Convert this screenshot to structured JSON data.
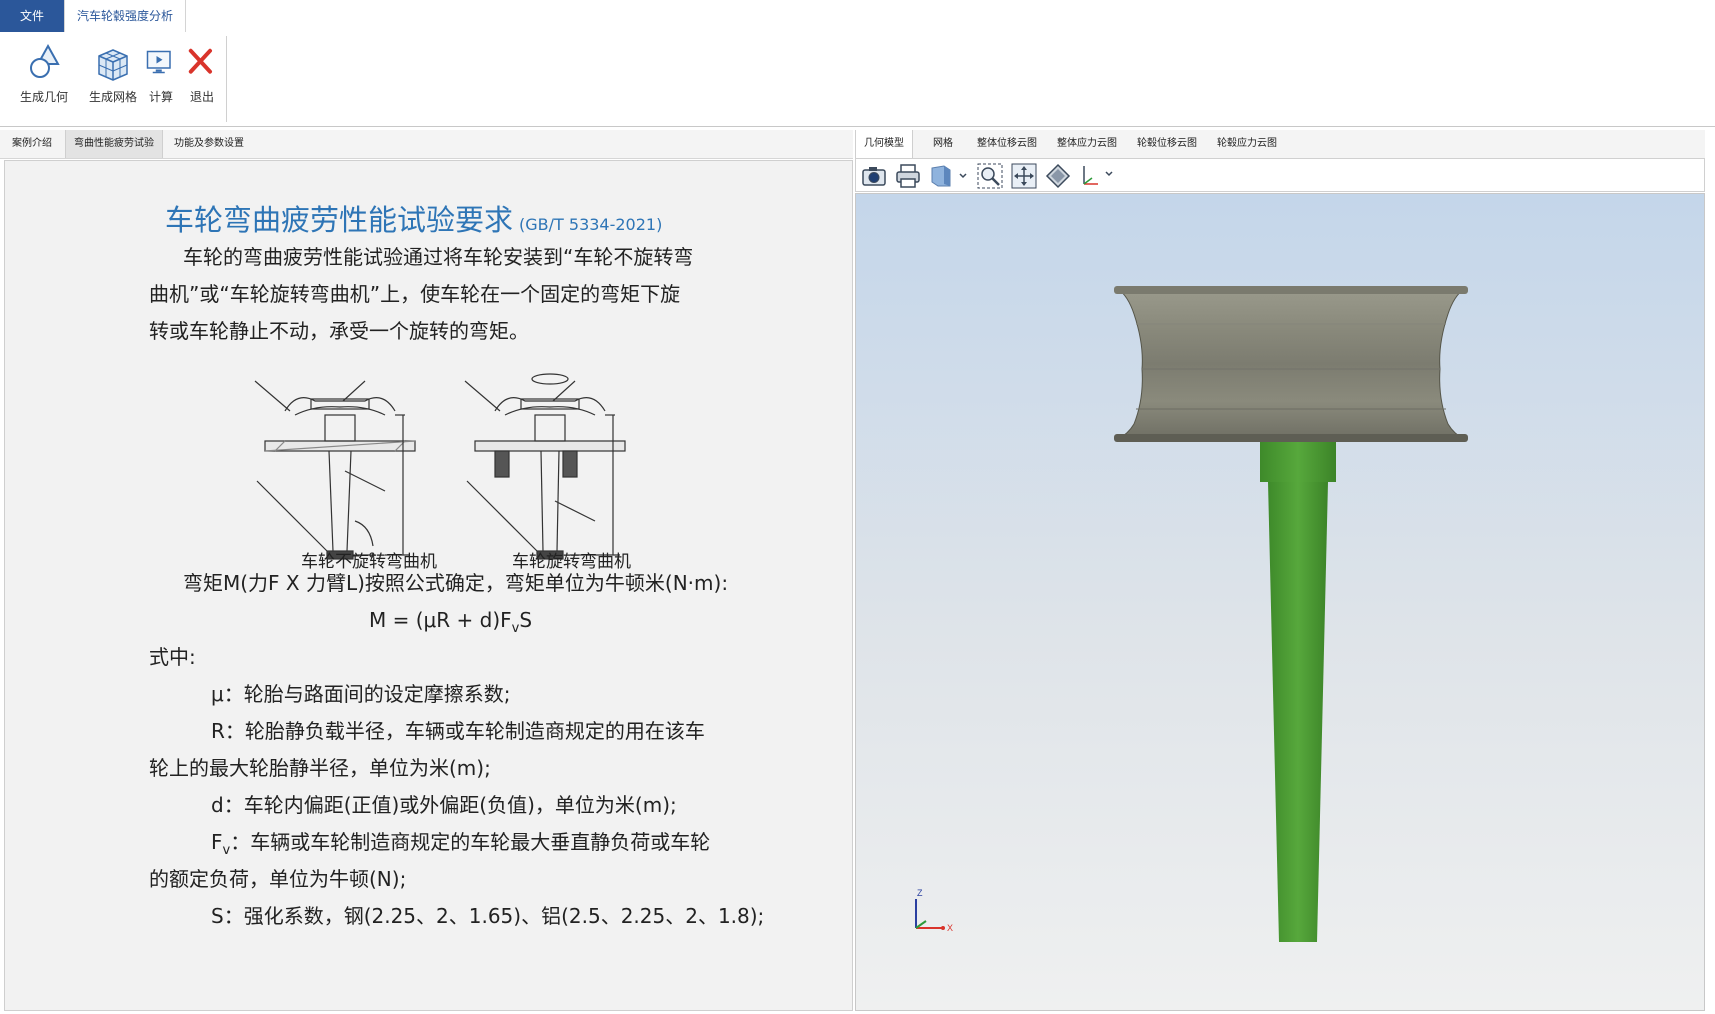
{
  "ribbon_tabs": {
    "file": "文件",
    "analysis": "汽车轮毂强度分析"
  },
  "ribbon": {
    "gen_geometry": "生成几何",
    "gen_mesh": "生成网格",
    "compute": "计算",
    "exit": "退出"
  },
  "left_tabs": [
    "案例介绍",
    "弯曲性能疲劳试验",
    "功能及参数设置"
  ],
  "left_active_tab": "弯曲性能疲劳试验",
  "doc": {
    "title": "车轮弯曲疲劳性能试验要求",
    "title_std": "(GB/T 5334-2021)",
    "intro": [
      "车轮的弯曲疲劳性能试验通过将车轮安装到“车轮不旋转弯",
      "曲机”或“车轮旋转弯曲机”上，使车轮在一个固定的弯矩下旋",
      "转或车轮静止不动，承受一个旋转的弯矩。"
    ],
    "fig_caption_left": "车轮不旋转弯曲机",
    "fig_caption_right": "车轮旋转弯曲机",
    "moment_text": "弯矩M(力F X 力臂L)按照公式确定，弯矩单位为牛顿米(N·m):",
    "formula_prefix": "M = (μR + d)F",
    "formula_sub": "v",
    "formula_suffix": "S",
    "where": "式中:",
    "mu": "μ：轮胎与路面间的设定摩擦系数;",
    "r_line1": "R：轮胎静负载半径，车辆或车轮制造商规定的用在该车",
    "r_line2": "轮上的最大轮胎静半径，单位为米(m);",
    "d_line": "d：车轮内偏距(正值)或外偏距(负值)，单位为米(m);",
    "fv_prefix": "F",
    "fv_sub": "v",
    "fv_line1": "：车辆或车轮制造商规定的车轮最大垂直静负荷或车轮",
    "fv_line2": "的额定负荷，单位为牛顿(N);",
    "s_line": "S：强化系数，钢(2.25、2、1.65)、铝(2.5、2.25、2、1.8);"
  },
  "view_tabs": [
    "几何模型",
    "网格",
    "整体位移云图",
    "整体应力云图",
    "轮毂位移云图",
    "轮毂应力云图"
  ],
  "view_active_tab": "几何模型",
  "axis": {
    "z": "Z",
    "x": "X"
  },
  "colors": {
    "accent": "#2b579a",
    "title_blue": "#2e75b6",
    "rim": "#8a8a7c",
    "shaft": "#4a9a32"
  },
  "toolbar_icons": [
    "camera-icon",
    "print-icon",
    "view-cube-icon",
    "zoom-fit-icon",
    "pan-icon",
    "rotate-icon",
    "axis-icon"
  ]
}
